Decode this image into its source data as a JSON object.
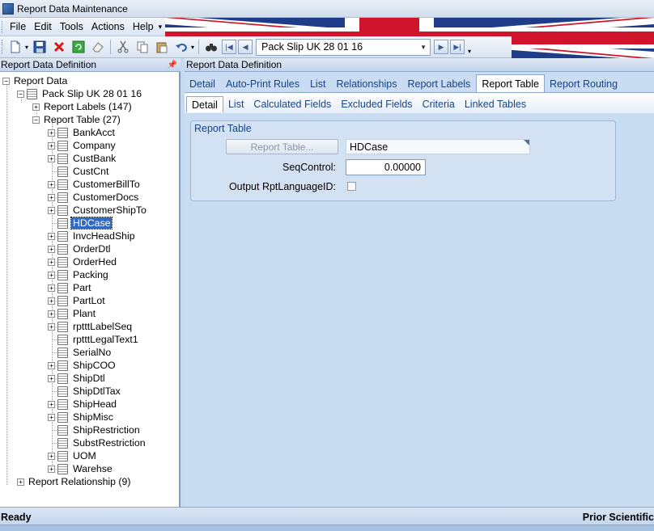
{
  "window": {
    "title": "Report Data Maintenance"
  },
  "menu": [
    "File",
    "Edit",
    "Tools",
    "Actions",
    "Help"
  ],
  "toolbar": {
    "icons": [
      "new-icon",
      "save-icon",
      "delete-icon",
      "refresh-icon",
      "clear-icon",
      "cut-icon",
      "copy-icon",
      "paste-icon",
      "undo-icon",
      "find-icon",
      "first-record-icon",
      "previous-record-icon",
      "next-record-icon",
      "last-record-icon"
    ],
    "record_combo": "Pack Slip UK 28 01 16"
  },
  "left_panel": {
    "title": "Report Data Definition",
    "tree": {
      "root": "Report Data",
      "report": "Pack Slip UK 28 01 16",
      "labels_node": "Report Labels (147)",
      "table_node": "Report Table (27)",
      "tables": [
        {
          "label": "BankAcct",
          "expandable": true
        },
        {
          "label": "Company",
          "expandable": true
        },
        {
          "label": "CustBank",
          "expandable": true
        },
        {
          "label": "CustCnt",
          "expandable": false
        },
        {
          "label": "CustomerBillTo",
          "expandable": true
        },
        {
          "label": "CustomerDocs",
          "expandable": true
        },
        {
          "label": "CustomerShipTo",
          "expandable": true
        },
        {
          "label": "HDCase",
          "expandable": false,
          "selected": true
        },
        {
          "label": "InvcHeadShip",
          "expandable": true
        },
        {
          "label": "OrderDtl",
          "expandable": true
        },
        {
          "label": "OrderHed",
          "expandable": true
        },
        {
          "label": "Packing",
          "expandable": true
        },
        {
          "label": "Part",
          "expandable": true
        },
        {
          "label": "PartLot",
          "expandable": true
        },
        {
          "label": "Plant",
          "expandable": true
        },
        {
          "label": "rptttLabelSeq",
          "expandable": true
        },
        {
          "label": "rptttLegalText1",
          "expandable": false
        },
        {
          "label": "SerialNo",
          "expandable": false
        },
        {
          "label": "ShipCOO",
          "expandable": true
        },
        {
          "label": "ShipDtl",
          "expandable": true
        },
        {
          "label": "ShipDtlTax",
          "expandable": false
        },
        {
          "label": "ShipHead",
          "expandable": true
        },
        {
          "label": "ShipMisc",
          "expandable": true
        },
        {
          "label": "ShipRestriction",
          "expandable": false
        },
        {
          "label": "SubstRestriction",
          "expandable": false
        },
        {
          "label": "UOM",
          "expandable": true
        },
        {
          "label": "Warehse",
          "expandable": true
        }
      ],
      "relationship_node": "Report Relationship (9)"
    }
  },
  "right_panel": {
    "title": "Report Data Definition",
    "main_tabs": [
      "Detail",
      "Auto-Print Rules",
      "List",
      "Relationships",
      "Report Labels",
      "Report Table",
      "Report Routing"
    ],
    "main_active": 5,
    "sub_tabs": [
      "Detail",
      "List",
      "Calculated Fields",
      "Excluded Fields",
      "Criteria",
      "Linked Tables"
    ],
    "sub_active": 0,
    "group": {
      "title": "Report Table",
      "report_table_button": "Report Table...",
      "report_table_value": "HDCase",
      "seq_label": "SeqControl:",
      "seq_value": "0.00000",
      "lang_label": "Output RptLanguageID:",
      "lang_checked": false
    }
  },
  "status": {
    "left": "Ready",
    "right": "Prior Scientific"
  }
}
